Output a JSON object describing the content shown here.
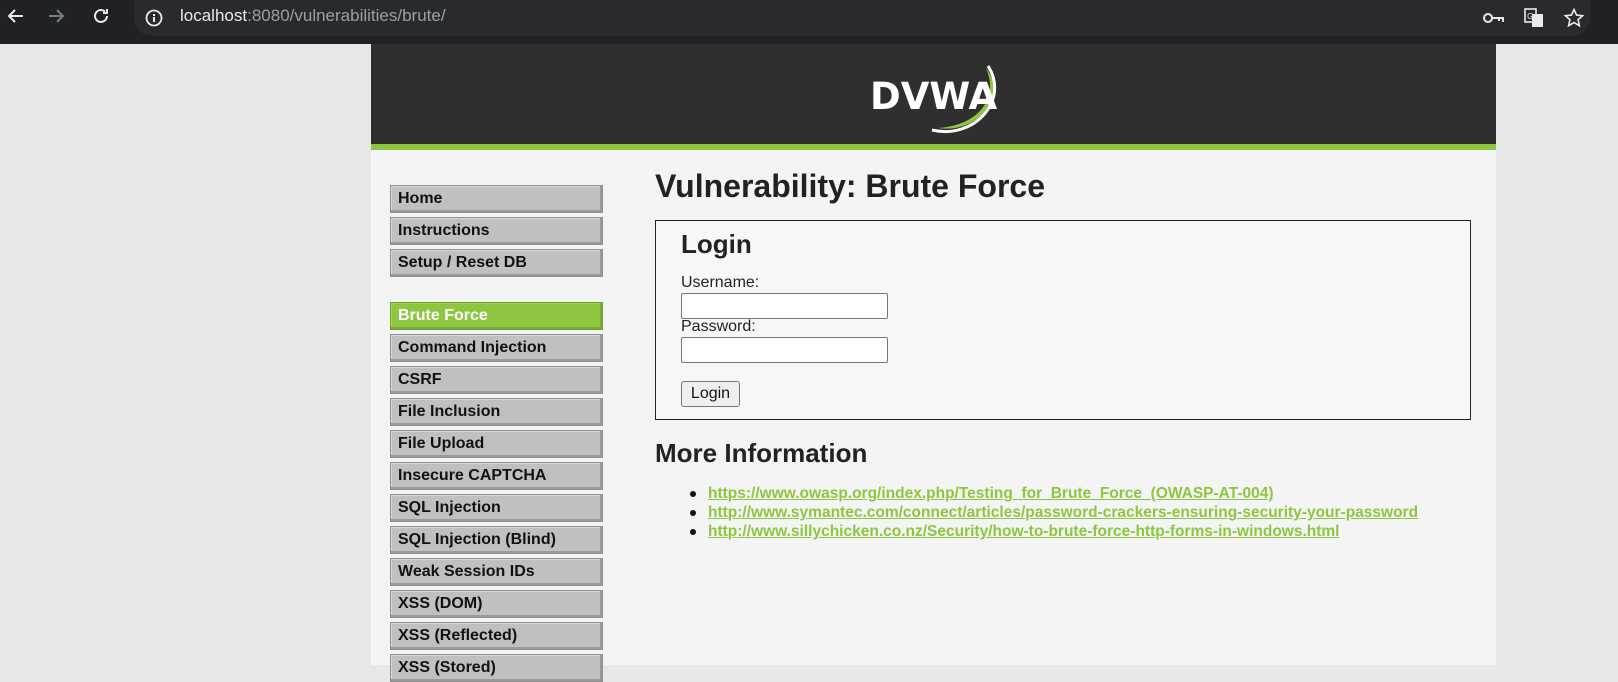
{
  "browser": {
    "url_host": "localhost",
    "url_path": ":8080/vulnerabilities/brute/",
    "icons": [
      "back-icon",
      "forward-icon",
      "reload-icon",
      "site-info-icon",
      "password-key-icon",
      "translate-icon",
      "bookmark-star-icon"
    ]
  },
  "header": {
    "logo_text": "DVWA",
    "colors": {
      "header_bg": "#2f2f2f",
      "accent": "#8dc63f"
    }
  },
  "menu": {
    "items": [
      {
        "label": "Home",
        "selected": false
      },
      {
        "label": "Instructions",
        "selected": false
      },
      {
        "label": "Setup / Reset DB",
        "selected": false
      },
      {
        "label": "Brute Force",
        "selected": true
      },
      {
        "label": "Command Injection",
        "selected": false
      },
      {
        "label": "CSRF",
        "selected": false
      },
      {
        "label": "File Inclusion",
        "selected": false
      },
      {
        "label": "File Upload",
        "selected": false
      },
      {
        "label": "Insecure CAPTCHA",
        "selected": false
      },
      {
        "label": "SQL Injection",
        "selected": false
      },
      {
        "label": "SQL Injection (Blind)",
        "selected": false
      },
      {
        "label": "Weak Session IDs",
        "selected": false
      },
      {
        "label": "XSS (DOM)",
        "selected": false
      },
      {
        "label": "XSS (Reflected)",
        "selected": false
      },
      {
        "label": "XSS (Stored)",
        "selected": false
      }
    ]
  },
  "main": {
    "title": "Vulnerability: Brute Force",
    "login": {
      "title": "Login",
      "username_label": "Username:",
      "username_value": "",
      "password_label": "Password:",
      "password_value": "",
      "button_label": "Login"
    },
    "more_info": {
      "title": "More Information",
      "links": [
        "https://www.owasp.org/index.php/Testing_for_Brute_Force_(OWASP-AT-004)",
        "http://www.symantec.com/connect/articles/password-crackers-ensuring-security-your-password",
        "http://www.sillychicken.co.nz/Security/how-to-brute-force-http-forms-in-windows.html"
      ]
    }
  }
}
